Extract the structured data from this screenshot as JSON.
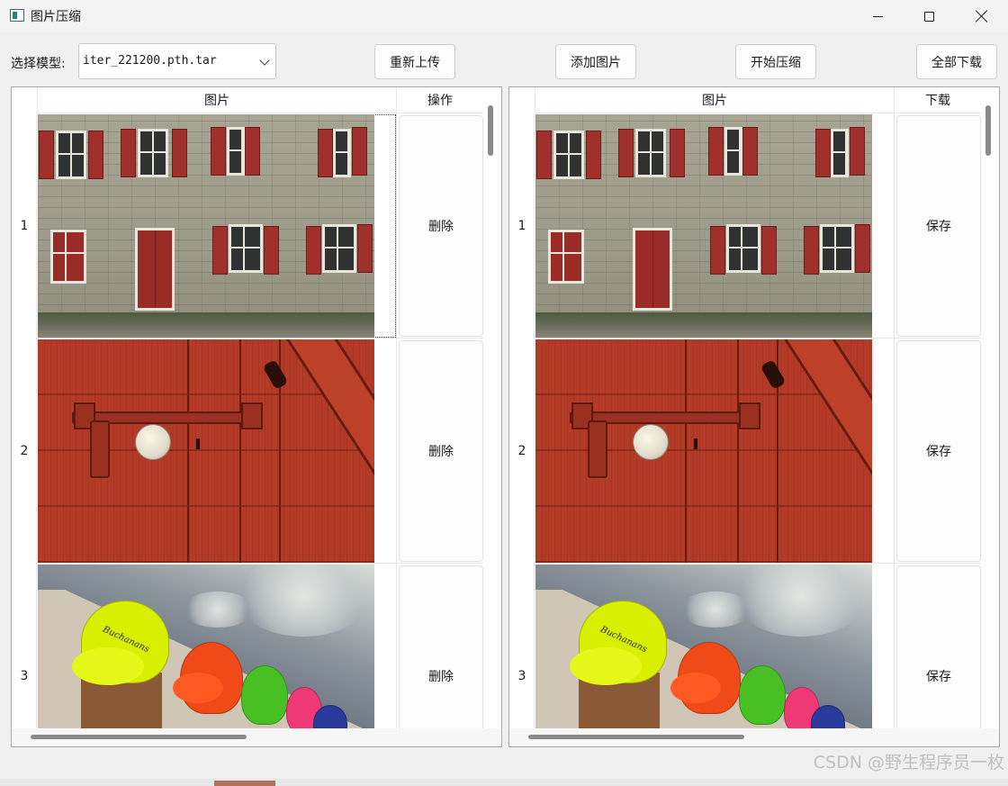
{
  "window": {
    "title": "图片压缩",
    "icons": {
      "app": "app-window-icon",
      "minimize": "minimize-icon",
      "maximize": "maximize-icon",
      "close": "close-icon"
    }
  },
  "toolbar": {
    "model_label": "选择模型:",
    "model_value": "iter_221200.pth.tar",
    "reupload_label": "重新上传",
    "add_image_label": "添加图片",
    "start_compress_label": "开始压缩",
    "download_all_label": "全部下载"
  },
  "left_table": {
    "headers": {
      "image": "图片",
      "action": "操作"
    },
    "rows": [
      {
        "index": "1",
        "action": "删除",
        "image": "building-wall-photo"
      },
      {
        "index": "2",
        "action": "删除",
        "image": "red-door-photo"
      },
      {
        "index": "3",
        "action": "删除",
        "image": "caps-photo"
      }
    ],
    "selected_row": "1"
  },
  "right_table": {
    "headers": {
      "image": "图片",
      "action": "下载"
    },
    "rows": [
      {
        "index": "1",
        "action": "保存",
        "image": "building-wall-photo"
      },
      {
        "index": "2",
        "action": "保存",
        "image": "red-door-photo"
      },
      {
        "index": "3",
        "action": "保存",
        "image": "caps-photo"
      }
    ]
  },
  "watermark": "CSDN @野生程序员一枚",
  "colors": {
    "window_bg": "#f0f0f0",
    "panel_bg": "#ffffff",
    "scrollbar": "#8a8a8a"
  }
}
